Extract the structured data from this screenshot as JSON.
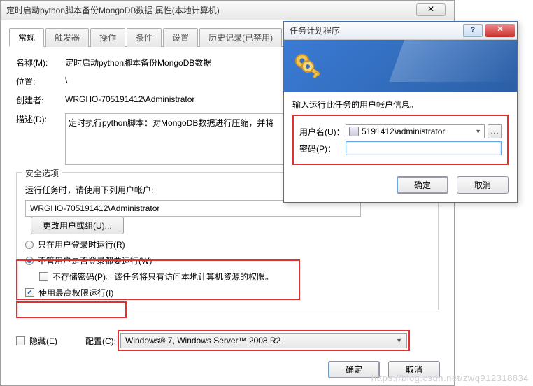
{
  "main": {
    "title": "定时启动python脚本备份MongoDB数据 属性(本地计算机)",
    "close_glyph": "✕",
    "tabs": [
      "常规",
      "触发器",
      "操作",
      "条件",
      "设置",
      "历史记录(已禁用)"
    ],
    "name_label": "名称(M):",
    "name_value": "定时启动python脚本备份MongoDB数据",
    "location_label": "位置:",
    "location_value": "\\",
    "author_label": "创建者:",
    "author_value": "WRGHO-705191412\\Administrator",
    "desc_label": "描述(D):",
    "desc_value": "定时执行python脚本：对MongoDB数据进行压缩，并将",
    "security": {
      "legend": "安全选项",
      "run_as_label": "运行任务时，请使用下列用户帐户:",
      "account": "WRGHO-705191412\\Administrator",
      "change_btn": "更改用户或组(U)...",
      "radio_logged_on": "只在用户登录时运行(R)",
      "radio_any": "不管用户是否登录都要运行(W)",
      "check_nopw": "不存储密码(P)。该任务将只有访问本地计算机资源的权限。",
      "check_highest": "使用最高权限运行(I)"
    },
    "hidden_label": "隐藏(E)",
    "config_label": "配置(C):",
    "config_value": "Windows® 7, Windows Server™ 2008 R2",
    "ok": "确定",
    "cancel": "取消"
  },
  "cred": {
    "title": "任务计划程序",
    "help_glyph": "?",
    "close_glyph": "✕",
    "instr": "输入运行此任务的用户帐户信息。",
    "user_label": "用户名(U)：",
    "user_value": "5191412\\administrator",
    "pass_label": "密码(P)：",
    "browse_glyph": "…",
    "ok": "确定",
    "cancel": "取消"
  },
  "watermark": "https://blog.csdn.net/zwq912318834"
}
